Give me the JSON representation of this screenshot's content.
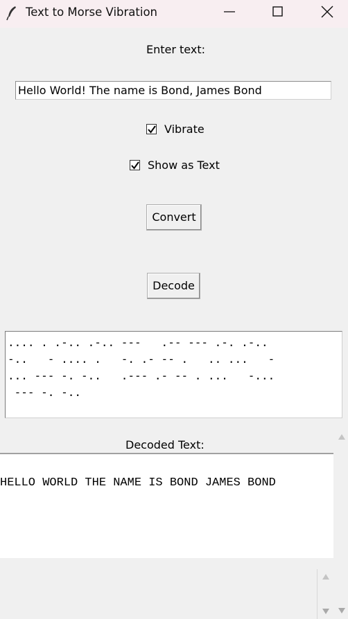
{
  "window": {
    "title": "Text to Morse Vibration",
    "icon": "feather-icon"
  },
  "form": {
    "enter_label": "Enter text:",
    "input_value": "Hello World! The name is Bond, James Bond",
    "vibrate_label": "Vibrate",
    "vibrate_checked": true,
    "show_text_label": "Show as Text",
    "show_text_checked": true,
    "convert_label": "Convert",
    "decode_label": "Decode"
  },
  "morse_output": {
    "lines": [
      ".... . .-.. .-.. ---   .-- --- .-. .-..",
      "-..   - .... .   -. .- -- .   .. ...   -",
      "... --- -. -..   .--- .- -- . ...   -...",
      " --- -. -.."
    ]
  },
  "decoded": {
    "label": "Decoded Text:",
    "text": "HELLO WORLD THE NAME IS BOND JAMES BOND"
  }
}
